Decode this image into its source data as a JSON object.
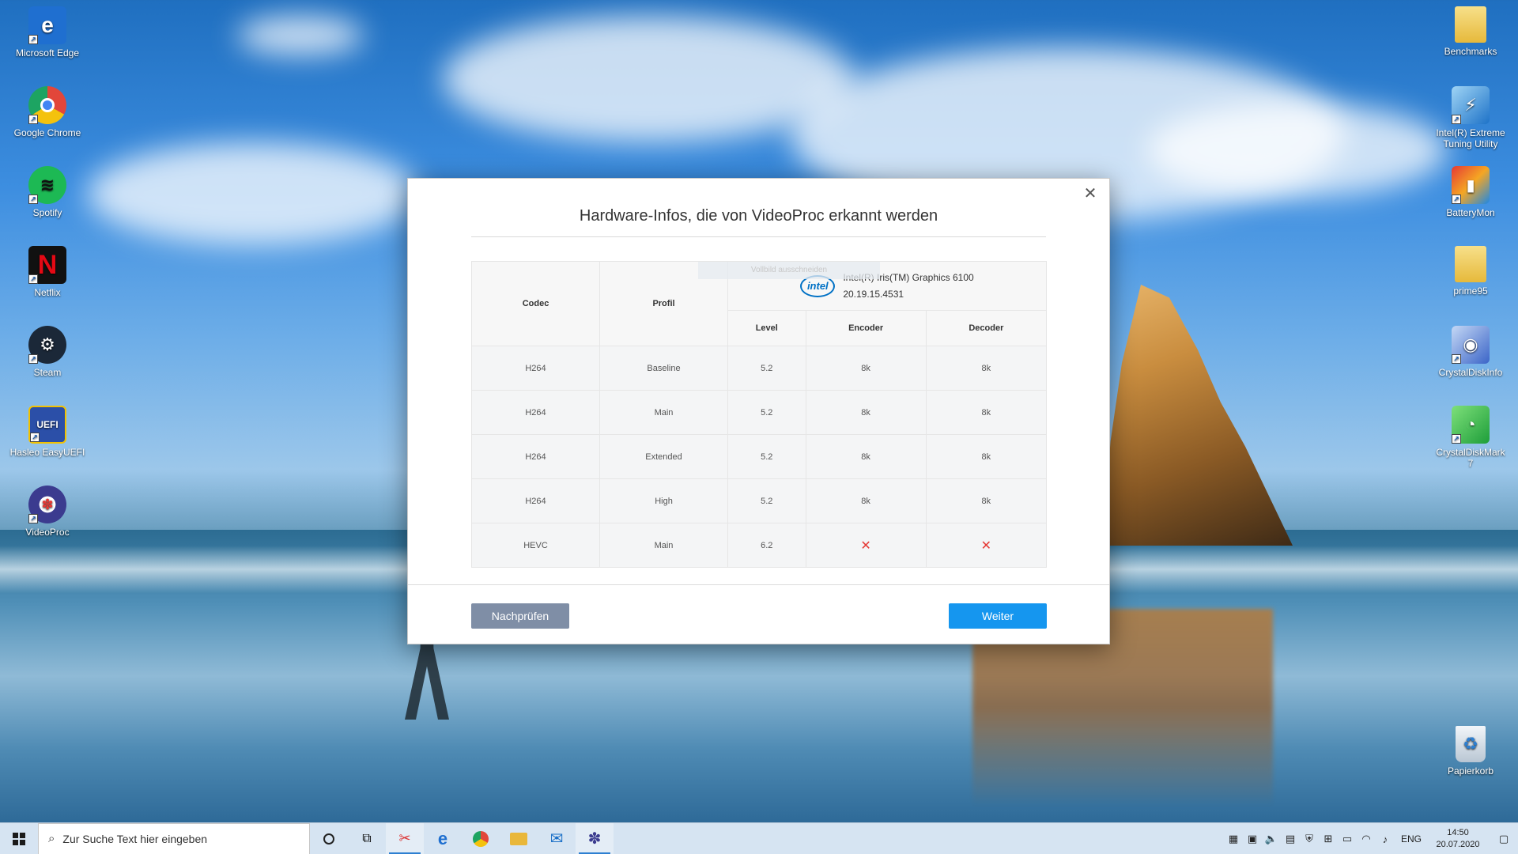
{
  "desktop": {
    "left_icons": [
      {
        "label": "Microsoft Edge",
        "icon": "edge-icon",
        "color": "#1f6fd0"
      },
      {
        "label": "Google Chrome",
        "icon": "chrome-icon",
        "color": "#e2463a"
      },
      {
        "label": "Spotify",
        "icon": "spotify-icon",
        "color": "#1db954"
      },
      {
        "label": "Netflix",
        "icon": "netflix-icon",
        "color": "#e50914"
      },
      {
        "label": "Steam",
        "icon": "steam-icon",
        "color": "#1b2838"
      },
      {
        "label": "Hasleo EasyUEFI",
        "icon": "easyuefi-icon",
        "color": "#2b4fa8"
      },
      {
        "label": "VideoProc",
        "icon": "videoproc-icon",
        "color": "#3b3b8f"
      }
    ],
    "right_icons": [
      {
        "label": "Benchmarks",
        "icon": "folder-icon"
      },
      {
        "label": "Intel(R) Extreme Tuning Utility",
        "icon": "intel-xtu-icon"
      },
      {
        "label": "BatteryMon",
        "icon": "batterymon-icon"
      },
      {
        "label": "prime95",
        "icon": "folder-icon"
      },
      {
        "label": "CrystalDiskInfo",
        "icon": "crystaldiskinfo-icon"
      },
      {
        "label": "CrystalDiskMark 7",
        "icon": "crystaldiskmark-icon"
      },
      {
        "label": "Papierkorb",
        "icon": "recycle-bin-icon"
      }
    ]
  },
  "dialog": {
    "title": "Hardware-Infos, die von VideoProc erkannt werden",
    "close_glyph": "✕",
    "ghost_tooltip": "Vollbild ausschneiden",
    "headers": {
      "codec": "Codec",
      "profile": "Profil",
      "level": "Level",
      "encoder": "Encoder",
      "decoder": "Decoder"
    },
    "gpu": {
      "logo_text": "intel",
      "name": "Intel(R) Iris(TM) Graphics 6100",
      "driver": "20.19.15.4531"
    },
    "rows": [
      {
        "codec": "H264",
        "profile": "Baseline",
        "level": "5.2",
        "encoder": "8k",
        "decoder": "8k"
      },
      {
        "codec": "H264",
        "profile": "Main",
        "level": "5.2",
        "encoder": "8k",
        "decoder": "8k"
      },
      {
        "codec": "H264",
        "profile": "Extended",
        "level": "5.2",
        "encoder": "8k",
        "decoder": "8k"
      },
      {
        "codec": "H264",
        "profile": "High",
        "level": "5.2",
        "encoder": "8k",
        "decoder": "8k"
      },
      {
        "codec": "HEVC",
        "profile": "Main",
        "level": "6.2",
        "encoder": "✕",
        "decoder": "✕"
      }
    ],
    "buttons": {
      "check": "Nachprüfen",
      "next": "Weiter"
    },
    "colors": {
      "check": "#7f8ea6",
      "next": "#1596ef",
      "unsupported": "#e53935"
    }
  },
  "taskbar": {
    "search_placeholder": "Zur Suche Text hier eingeben",
    "language": "ENG",
    "time": "14:50",
    "date": "20.07.2020"
  }
}
